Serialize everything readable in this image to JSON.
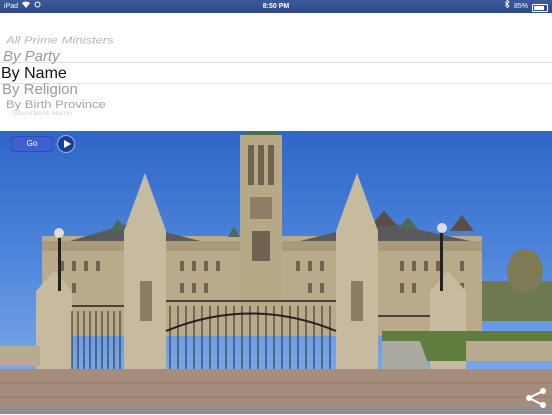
{
  "status_bar": {
    "device": "iPad",
    "time": "8:50 PM",
    "battery": "85%",
    "icons": [
      "wifi-icon",
      "sync-icon",
      "bluetooth-icon",
      "battery-icon"
    ]
  },
  "picker": {
    "items": [
      "All Prime Ministers",
      "By Party",
      "By Name",
      "By Religion",
      "By Birth Province",
      "Shortest term"
    ],
    "selected": "By Name"
  },
  "controls": {
    "go_label": "Go",
    "play_icon": "play-arrow-icon",
    "share_icon": "share-icon"
  },
  "photo": {
    "subject": "parliament-building-photo",
    "colors": {
      "sky": "#3a74d2",
      "stone": "#b8aa8a",
      "roof": "#4d6a52",
      "iron": "#222222"
    }
  }
}
